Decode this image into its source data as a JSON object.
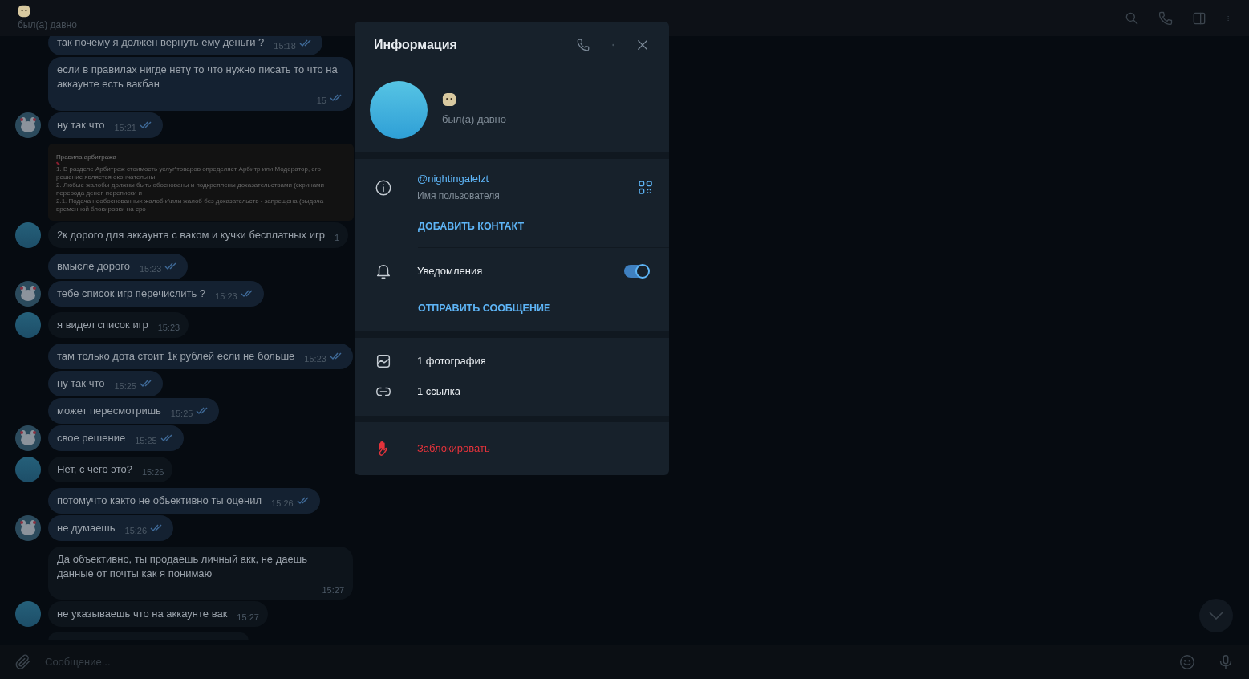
{
  "header": {
    "status": "был(а) давно"
  },
  "messages": [
    {
      "kind": "text",
      "text": "так почему я должен вернуть ему деньги ?",
      "time": "15:18",
      "outgoing": true,
      "read": true,
      "avatar": false
    },
    {
      "kind": "text",
      "text": "если в правилах нигде нету то что нужно писать то что на аккаунте есть вакбан",
      "time": "15",
      "outgoing": true,
      "read": true,
      "avatar": false
    },
    {
      "kind": "text",
      "text": "ну так что",
      "time": "15:21",
      "outgoing": true,
      "read": true,
      "avatar": true
    },
    {
      "kind": "image",
      "avatar": false,
      "document": {
        "title": "Правила арбитража",
        "lines": [
          "1. В разделе Арбитраж стоимость услуг\\товаров определяет Арбитр или Модератор, его решение является окончательны",
          "2. Любые жалобы должны быть обоснованы и подкреплены доказательствами (скринами перевода денег, переписки и",
          "2.1. Подача необоснованных жалоб и\\или жалоб без доказательств - запрещена (выдача временной блокировки на сро"
        ]
      }
    },
    {
      "kind": "text",
      "text": "2к дорого для аккаунта с ваком и кучки бесплатных игр",
      "time": "1",
      "outgoing": false,
      "avatar": true
    },
    {
      "kind": "text",
      "text": "вмысле дорого",
      "time": "15:23",
      "outgoing": true,
      "read": true,
      "avatar": false
    },
    {
      "kind": "text",
      "text": "тебе список игр перечислить ?",
      "time": "15:23",
      "outgoing": true,
      "read": true,
      "avatar": true
    },
    {
      "kind": "text",
      "text": "я видел список игр",
      "time": "15:23",
      "outgoing": false,
      "avatar": true
    },
    {
      "kind": "text",
      "text": "там только дота стоит 1к рублей если не больше",
      "time": "15:23",
      "outgoing": true,
      "read": true,
      "avatar": false
    },
    {
      "kind": "text",
      "text": "ну так что",
      "time": "15:25",
      "outgoing": true,
      "read": true,
      "avatar": false
    },
    {
      "kind": "text",
      "text": "может пересмотришь",
      "time": "15:25",
      "outgoing": true,
      "read": true,
      "avatar": false
    },
    {
      "kind": "text",
      "text": "свое решение",
      "time": "15:25",
      "outgoing": true,
      "read": true,
      "avatar": true
    },
    {
      "kind": "text",
      "text": "Нет, с чего это?",
      "time": "15:26",
      "outgoing": false,
      "avatar": true
    },
    {
      "kind": "text",
      "text": "потомучто както не обьективно ты оценил",
      "time": "15:26",
      "outgoing": true,
      "read": true,
      "avatar": false
    },
    {
      "kind": "text",
      "text": "не думаешь",
      "time": "15:26",
      "outgoing": true,
      "read": true,
      "avatar": true
    },
    {
      "kind": "text",
      "text": "Да объективно, ты продаешь личный акк, не даешь данные от почты как я понимаю",
      "time": "15:27",
      "outgoing": false,
      "avatar": false
    },
    {
      "kind": "text",
      "text": "не указываешь что на аккаунте вак",
      "time": "15:27",
      "outgoing": false,
      "avatar": true
    },
    {
      "kind": "partial",
      "outgoing": false,
      "avatar": false
    }
  ],
  "composer": {
    "placeholder": "Сообщение..."
  },
  "info_panel": {
    "title": "Информация",
    "status": "был(а) давно",
    "username": "@nightingalelzt",
    "username_label": "Имя пользователя",
    "add_contact": "ДОБАВИТЬ КОНТАКТ",
    "notifications": {
      "label": "Уведомления",
      "on": true
    },
    "send_message": "ОТПРАВИТЬ СООБЩЕНИЕ",
    "media": [
      {
        "kind": "photos",
        "label": "1 фотография"
      },
      {
        "kind": "links",
        "label": "1 ссылка"
      }
    ],
    "block": "Заблокировать"
  }
}
